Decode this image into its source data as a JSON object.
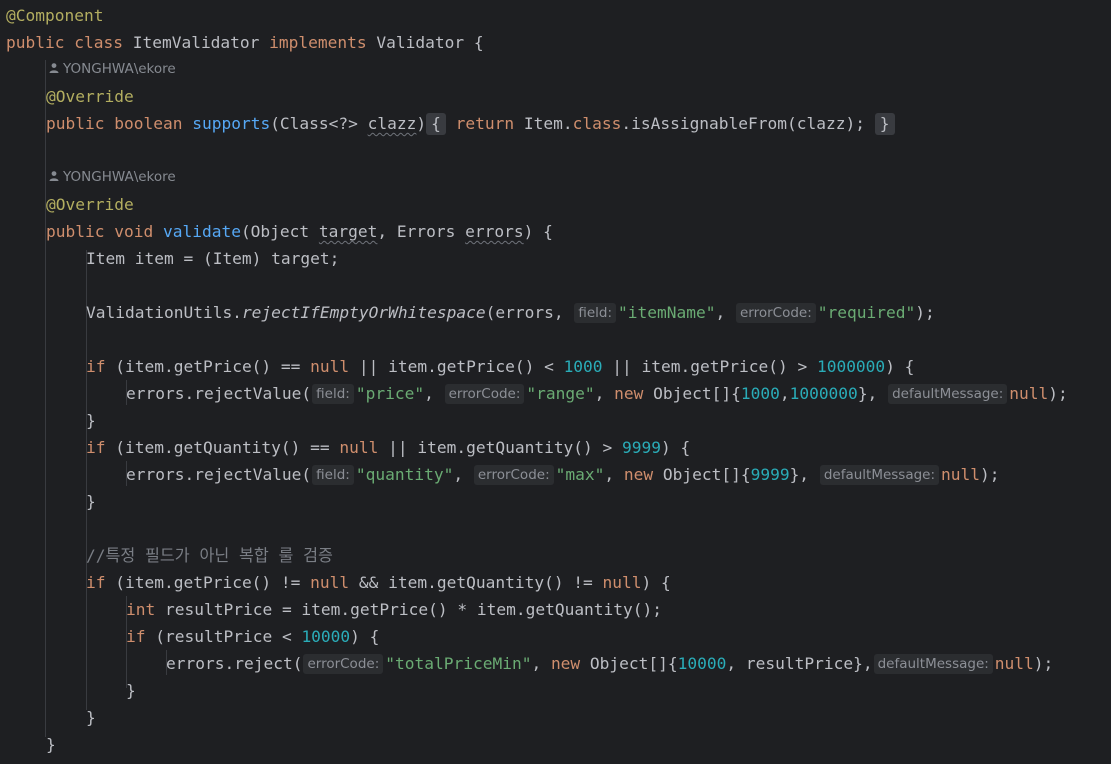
{
  "code": {
    "l1_component": "@Component",
    "l2_public": "public",
    "l2_class": "class",
    "l2_name": "ItemValidator",
    "l2_implements": "implements",
    "l2_iface": "Validator {",
    "author": "YONGHWA\\ekore",
    "override": "@Override",
    "l4_public": "public",
    "l4_boolean": "boolean",
    "l4_supports": "supports",
    "l4_paren": "(Class<?> ",
    "l4_clazz": "clazz",
    "l4_close": ")",
    "l4_fold_open": "{",
    "l4_return": "return",
    "l4_body1": " Item.",
    "l4_class_kw": "class",
    "l4_body2": ".isAssignableFrom(clazz);",
    "l4_fold_close": "}",
    "l7_public": "public",
    "l7_void": "void",
    "l7_validate": "validate",
    "l7_args1": "(Object ",
    "l7_target": "target",
    "l7_args2": ", Errors ",
    "l7_errors": "errors",
    "l7_args3": ") {",
    "l8": "Item item = (Item) target;",
    "l10_pre": "ValidationUtils.",
    "l10_method": "rejectIfEmptyOrWhitespace",
    "l10_args": "(errors, ",
    "hint_field": "field:",
    "hint_errorCode": "errorCode:",
    "hint_defaultMessage": "defaultMessage:",
    "l10_itemName": "\"itemName\"",
    "l10_required": "\"required\"",
    "l10_end": ");",
    "if": "if",
    "null": "null",
    "new": "new",
    "int": "int",
    "l12_a": " (item.getPrice() == ",
    "l12_b": " || item.getPrice() < ",
    "l12_1000": "1000",
    "l12_c": " || item.getPrice() > ",
    "l12_1000000": "1000000",
    "l12_d": ") {",
    "l13_pre": "errors.rejectValue(",
    "l13_price": "\"price\"",
    "l13_range": "\"range\"",
    "l13_obj": " Object[]{",
    "l13_n1": "1000",
    "l13_n2": "1000000",
    "l13_obj_end": "},",
    "l13_end": ");",
    "brace_close": "}",
    "l15_a": " (item.getQuantity() == ",
    "l15_b": " || item.getQuantity() > ",
    "l15_9999": "9999",
    "l15_c": ") {",
    "l16_pre": "errors.rejectValue(",
    "l16_quantity": "\"quantity\"",
    "l16_max": "\"max\"",
    "l16_n": "9999",
    "l16_end": ");",
    "l19_comment": "//특정 필드가 아닌 복합 룰 검증",
    "l20_a": " (item.getPrice() != ",
    "l20_b": " && item.getQuantity() != ",
    "l20_c": ") {",
    "l21_rest": " resultPrice = item.getPrice() * item.getQuantity();",
    "l22_a": " (resultPrice < ",
    "l22_10000": "10000",
    "l22_b": ") {",
    "l23_pre": "errors.reject(",
    "l23_code": "\"totalPriceMin\"",
    "l23_n": "10000",
    "l23_rest": ", resultPrice},",
    "l23_end": ");"
  },
  "colors": {
    "background": "#1e1f22",
    "keyword": "#cf8e6d",
    "annotation": "#b3ae60",
    "function": "#56a8f5",
    "string": "#6aab73",
    "number": "#2aacb8",
    "comment": "#7a7e85",
    "default": "#bcbec4"
  }
}
